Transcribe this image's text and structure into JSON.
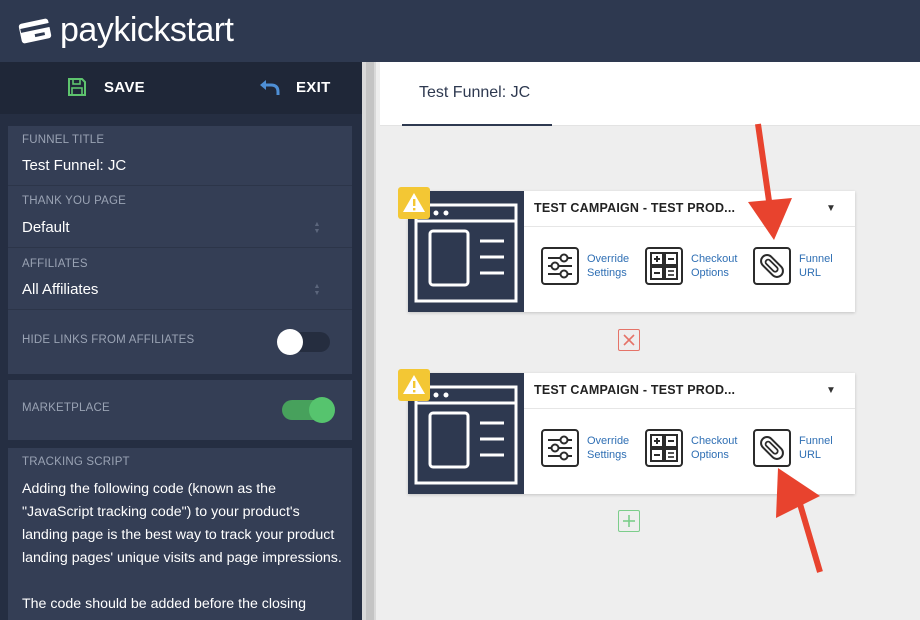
{
  "brand": {
    "logo_bold": "pay",
    "logo_rest": "kickstart"
  },
  "toolbar": {
    "save_label": "SAVE",
    "exit_label": "EXIT"
  },
  "sidebar": {
    "funnel_title_label": "FUNNEL TITLE",
    "funnel_title_value": "Test Funnel: JC",
    "thank_you_label": "THANK YOU PAGE",
    "thank_you_value": "Default",
    "affiliates_label": "AFFILIATES",
    "affiliates_value": "All Affiliates",
    "hide_links_label": "HIDE LINKS FROM AFFILIATES",
    "hide_links_on": false,
    "marketplace_label": "MARKETPLACE",
    "marketplace_on": true,
    "tracking_label": "TRACKING SCRIPT",
    "tracking_text": "Adding the following code (known as the \"JavaScript tracking code\") to your product's landing page is the best way to track your product landing pages' unique visits and page impressions.",
    "tracking_text_2": "The code should be added before the closing"
  },
  "main": {
    "tab_label": "Test Funnel: JC",
    "steps": [
      {
        "title": "TEST CAMPAIGN - TEST PROD...",
        "actions": [
          {
            "l1": "Override",
            "l2": "Settings"
          },
          {
            "l1": "Checkout",
            "l2": "Options"
          },
          {
            "l1": "Funnel",
            "l2": "URL"
          }
        ]
      },
      {
        "title": "TEST CAMPAIGN - TEST PROD...",
        "actions": [
          {
            "l1": "Override",
            "l2": "Settings"
          },
          {
            "l1": "Checkout",
            "l2": "Options"
          },
          {
            "l1": "Funnel",
            "l2": "URL"
          }
        ]
      }
    ]
  },
  "colors": {
    "header": "#2e3950",
    "sidebar": "#252e42",
    "panel": "#343e55",
    "link": "#2f6fb4",
    "warning": "#f3c734",
    "toggle_on": "#56c46e",
    "annotation_arrow": "#e8432e"
  },
  "icons": {
    "logo": "credit-card-icon",
    "save": "floppy-disk-icon",
    "exit": "undo-arrow-icon",
    "override": "sliders-icon",
    "checkout": "calculator-grid-icon",
    "funnel_url": "paperclip-link-icon",
    "warning": "warning-triangle-icon",
    "delete": "close-icon",
    "add": "plus-icon"
  }
}
